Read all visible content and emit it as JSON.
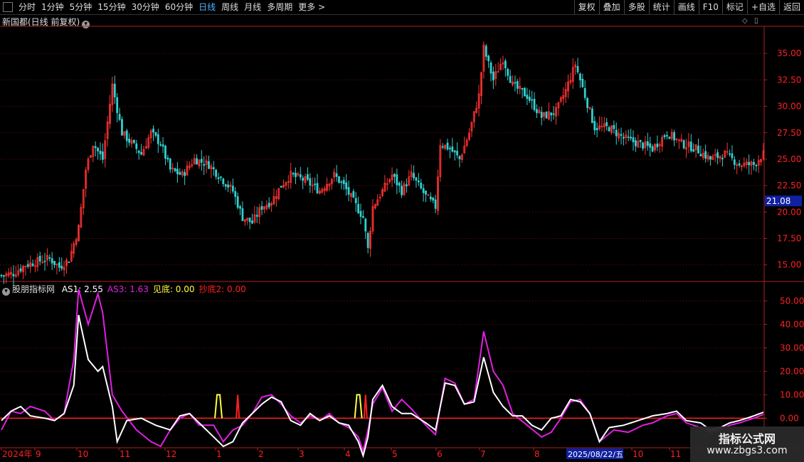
{
  "toolbar": {
    "periods": [
      "分时",
      "1分钟",
      "5分钟",
      "15分钟",
      "30分钟",
      "60分钟",
      "日线",
      "周线",
      "月线",
      "多周期",
      "更多"
    ],
    "active_period": "日线",
    "more_arrow": ">",
    "right_buttons": [
      "复权",
      "叠加",
      "多股",
      "统计",
      "画线",
      "F10",
      "标记",
      "+自选",
      "返回"
    ]
  },
  "main_title": "新国都(日线 前复权)",
  "indicator": {
    "name": "股朋指标网",
    "items": [
      {
        "label": "AS1: 2.55",
        "color": "#ffffff"
      },
      {
        "label": "AS3: 1.63",
        "color": "#e020e0"
      },
      {
        "label": "见底: 0.00",
        "color": "#ffff40"
      },
      {
        "label": "抄底2: 0.00",
        "color": "#ff2020"
      }
    ]
  },
  "price_axis": {
    "ticks": [
      "35.00",
      "32.50",
      "30.00",
      "27.50",
      "25.00",
      "22.50",
      "20.00",
      "17.50",
      "15.00"
    ],
    "current_price": "21.08"
  },
  "ind_axis": {
    "ticks": [
      "50.00",
      "40.00",
      "30.00",
      "20.00",
      "10.00",
      "0.00"
    ]
  },
  "time_axis": {
    "labels": [
      "2024年",
      "9",
      "10",
      "11",
      "12",
      "1",
      "2",
      "3",
      "4",
      "5",
      "6",
      "7",
      "8",
      "10",
      "11"
    ],
    "highlight_date": "2025/08/22/五"
  },
  "colors": {
    "up": "#ff3333",
    "down": "#33d0d0",
    "grid": "#6a1010",
    "axis": "#b02020",
    "as1": "#ffffff",
    "as3": "#e020e0",
    "jiandi": "#ffff40",
    "chaodi": "#ff2020",
    "accent": "#4fb3ff"
  },
  "watermark": {
    "line1": "指标公式网",
    "line2": "www.zbgs3.com"
  },
  "chart_data": {
    "type": "line",
    "price_range": [
      13.5,
      37.5
    ],
    "indicator_range": [
      -12,
      58
    ],
    "price_anchors": [
      [
        0,
        14.0
      ],
      [
        5,
        14.2
      ],
      [
        10,
        15.0
      ],
      [
        16,
        15.4
      ],
      [
        20,
        15.6
      ],
      [
        24,
        14.8
      ],
      [
        28,
        15.5
      ],
      [
        32,
        18.5
      ],
      [
        35,
        24.0
      ],
      [
        38,
        26.5
      ],
      [
        42,
        25.0
      ],
      [
        46,
        32.0
      ],
      [
        50,
        27.5
      ],
      [
        54,
        26.5
      ],
      [
        58,
        25.5
      ],
      [
        62,
        27.5
      ],
      [
        66,
        26.5
      ],
      [
        70,
        24.0
      ],
      [
        75,
        23.5
      ],
      [
        80,
        25.0
      ],
      [
        86,
        24.5
      ],
      [
        92,
        23.0
      ],
      [
        96,
        22.0
      ],
      [
        100,
        19.5
      ],
      [
        104,
        19.0
      ],
      [
        108,
        20.5
      ],
      [
        112,
        21.0
      ],
      [
        116,
        22.5
      ],
      [
        120,
        23.5
      ],
      [
        126,
        23.0
      ],
      [
        132,
        22.0
      ],
      [
        138,
        23.5
      ],
      [
        142,
        22.5
      ],
      [
        146,
        21.0
      ],
      [
        150,
        19.5
      ],
      [
        152,
        16.5
      ],
      [
        154,
        20.5
      ],
      [
        158,
        22.0
      ],
      [
        162,
        23.5
      ],
      [
        166,
        22.0
      ],
      [
        170,
        23.5
      ],
      [
        176,
        21.5
      ],
      [
        180,
        20.5
      ],
      [
        182,
        26.5
      ],
      [
        186,
        26.0
      ],
      [
        190,
        25.0
      ],
      [
        194,
        27.5
      ],
      [
        198,
        31.0
      ],
      [
        200,
        35.5
      ],
      [
        204,
        32.5
      ],
      [
        208,
        34.5
      ],
      [
        212,
        32.0
      ],
      [
        218,
        31.0
      ],
      [
        224,
        29.0
      ],
      [
        230,
        29.5
      ],
      [
        234,
        31.5
      ],
      [
        238,
        34.0
      ],
      [
        242,
        31.0
      ],
      [
        246,
        28.0
      ],
      [
        252,
        28.0
      ],
      [
        258,
        27.0
      ],
      [
        264,
        26.5
      ],
      [
        270,
        26.0
      ],
      [
        276,
        27.5
      ],
      [
        282,
        26.5
      ],
      [
        288,
        26.0
      ],
      [
        294,
        25.0
      ],
      [
        300,
        25.5
      ],
      [
        306,
        24.5
      ],
      [
        312,
        24.5
      ],
      [
        316,
        25.5
      ]
    ],
    "as1_anchors": [
      [
        0,
        -1
      ],
      [
        4,
        3
      ],
      [
        8,
        5
      ],
      [
        12,
        1
      ],
      [
        18,
        0
      ],
      [
        22,
        -1
      ],
      [
        26,
        2
      ],
      [
        30,
        14
      ],
      [
        32,
        44
      ],
      [
        36,
        25
      ],
      [
        40,
        20
      ],
      [
        42,
        22
      ],
      [
        46,
        5
      ],
      [
        48,
        -10
      ],
      [
        52,
        -1
      ],
      [
        58,
        0
      ],
      [
        64,
        -3
      ],
      [
        70,
        -5
      ],
      [
        74,
        1
      ],
      [
        78,
        2
      ],
      [
        82,
        -2
      ],
      [
        88,
        -8
      ],
      [
        92,
        -12
      ],
      [
        96,
        -10
      ],
      [
        100,
        -2
      ],
      [
        104,
        2
      ],
      [
        108,
        6
      ],
      [
        112,
        9
      ],
      [
        116,
        7
      ],
      [
        120,
        -1
      ],
      [
        124,
        -3
      ],
      [
        128,
        2
      ],
      [
        132,
        -1
      ],
      [
        136,
        1
      ],
      [
        140,
        -2
      ],
      [
        144,
        -3
      ],
      [
        148,
        -10
      ],
      [
        150,
        -16
      ],
      [
        152,
        -8
      ],
      [
        154,
        8
      ],
      [
        158,
        14
      ],
      [
        162,
        5
      ],
      [
        166,
        2
      ],
      [
        170,
        2
      ],
      [
        176,
        -2
      ],
      [
        180,
        -5
      ],
      [
        184,
        15
      ],
      [
        188,
        14
      ],
      [
        192,
        6
      ],
      [
        196,
        7
      ],
      [
        200,
        26
      ],
      [
        204,
        11
      ],
      [
        208,
        5
      ],
      [
        212,
        1
      ],
      [
        216,
        1
      ],
      [
        220,
        -3
      ],
      [
        224,
        -5
      ],
      [
        228,
        0
      ],
      [
        232,
        1
      ],
      [
        236,
        8
      ],
      [
        240,
        7
      ],
      [
        244,
        2
      ],
      [
        248,
        -10
      ],
      [
        252,
        -4
      ],
      [
        258,
        -3
      ],
      [
        264,
        -1
      ],
      [
        270,
        1
      ],
      [
        276,
        2
      ],
      [
        280,
        3
      ],
      [
        284,
        -1
      ],
      [
        290,
        -2
      ],
      [
        294,
        -5
      ],
      [
        298,
        -4
      ],
      [
        302,
        -2
      ],
      [
        306,
        -1
      ],
      [
        312,
        1
      ],
      [
        316,
        2.55
      ]
    ],
    "as3_anchors": [
      [
        0,
        -5
      ],
      [
        4,
        3
      ],
      [
        8,
        2
      ],
      [
        12,
        5
      ],
      [
        18,
        3
      ],
      [
        22,
        -1
      ],
      [
        26,
        2
      ],
      [
        30,
        25
      ],
      [
        32,
        55
      ],
      [
        36,
        40
      ],
      [
        40,
        53
      ],
      [
        42,
        45
      ],
      [
        46,
        10
      ],
      [
        50,
        3
      ],
      [
        56,
        -5
      ],
      [
        62,
        -10
      ],
      [
        66,
        -12
      ],
      [
        70,
        -5
      ],
      [
        74,
        0
      ],
      [
        78,
        2
      ],
      [
        82,
        -3
      ],
      [
        88,
        -3
      ],
      [
        92,
        -10
      ],
      [
        96,
        -5
      ],
      [
        100,
        -3
      ],
      [
        104,
        2
      ],
      [
        108,
        9
      ],
      [
        112,
        10
      ],
      [
        116,
        6
      ],
      [
        120,
        1
      ],
      [
        124,
        -2
      ],
      [
        128,
        1
      ],
      [
        132,
        -1
      ],
      [
        136,
        2
      ],
      [
        140,
        -2
      ],
      [
        144,
        -4
      ],
      [
        148,
        -8
      ],
      [
        150,
        -14
      ],
      [
        152,
        -5
      ],
      [
        154,
        6
      ],
      [
        158,
        13
      ],
      [
        162,
        3
      ],
      [
        166,
        8
      ],
      [
        170,
        4
      ],
      [
        176,
        -3
      ],
      [
        180,
        -7
      ],
      [
        184,
        17
      ],
      [
        188,
        15
      ],
      [
        192,
        6
      ],
      [
        196,
        8
      ],
      [
        200,
        37
      ],
      [
        204,
        20
      ],
      [
        208,
        14
      ],
      [
        212,
        2
      ],
      [
        218,
        -3
      ],
      [
        224,
        -8
      ],
      [
        228,
        -6
      ],
      [
        232,
        0
      ],
      [
        236,
        7
      ],
      [
        240,
        8
      ],
      [
        244,
        2
      ],
      [
        248,
        -10
      ],
      [
        254,
        -5
      ],
      [
        260,
        -6
      ],
      [
        266,
        -3
      ],
      [
        270,
        -2
      ],
      [
        276,
        1
      ],
      [
        280,
        2
      ],
      [
        284,
        -2
      ],
      [
        290,
        -4
      ],
      [
        294,
        -6
      ],
      [
        298,
        -5
      ],
      [
        302,
        -3
      ],
      [
        306,
        -2
      ],
      [
        312,
        0
      ],
      [
        316,
        1.63
      ]
    ],
    "jiandi_signals": [
      90,
      148
    ],
    "chaodi_signals": [
      98,
      151
    ]
  }
}
